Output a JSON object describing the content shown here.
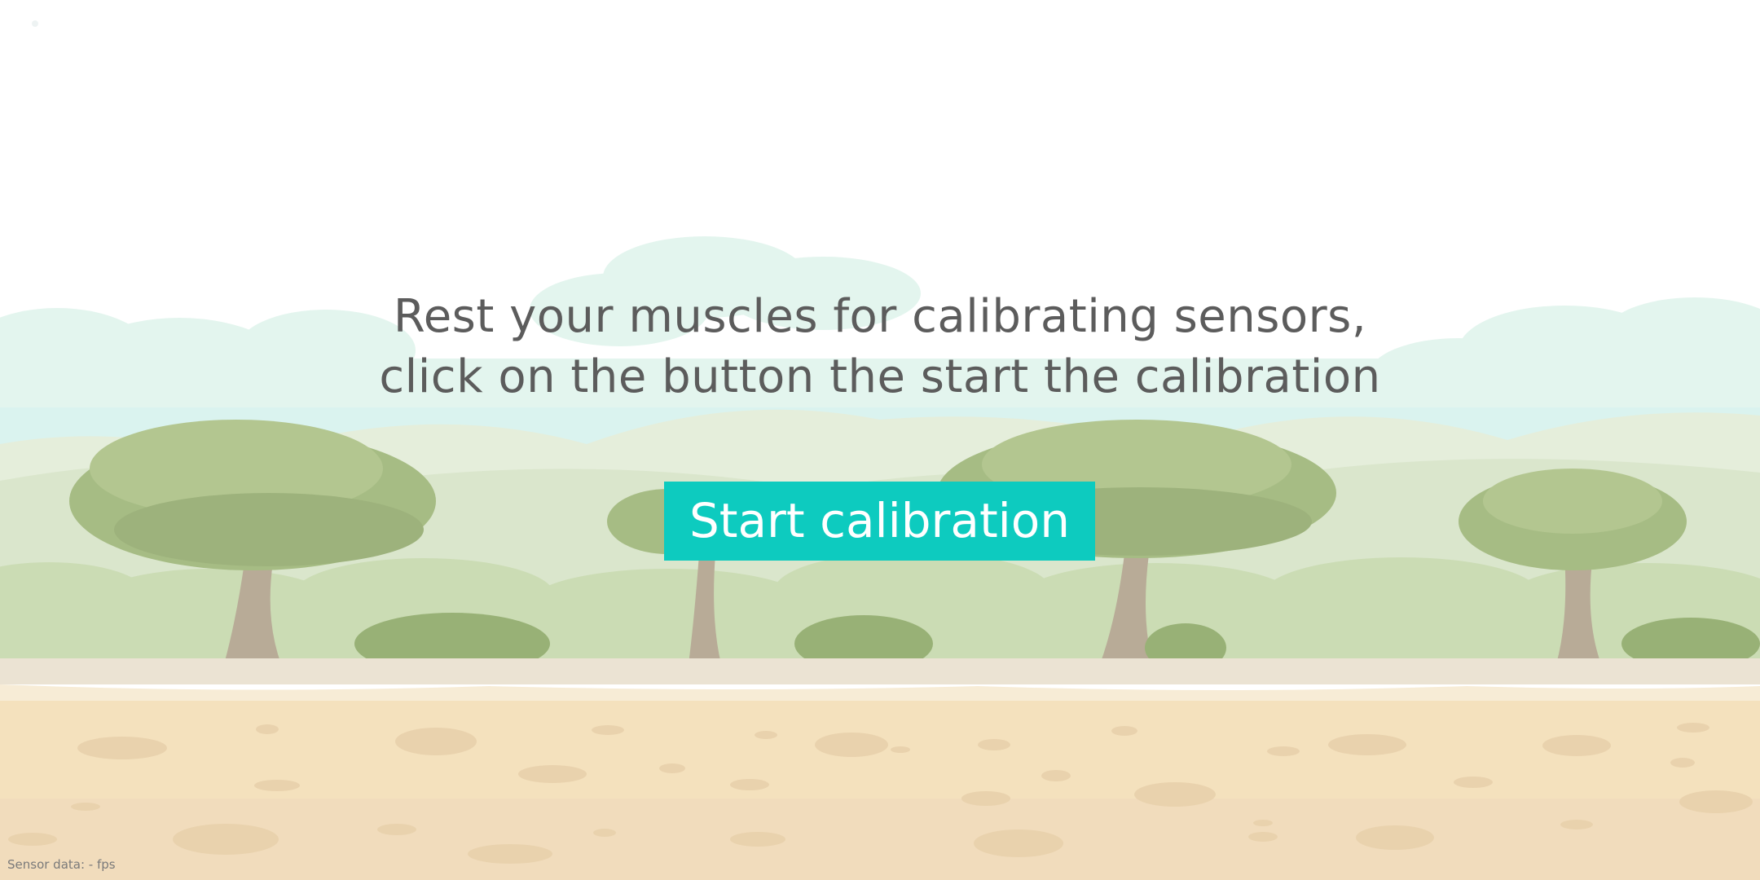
{
  "calibration": {
    "instruction_line1": "Rest your muscles for calibrating sensors,",
    "instruction_line2": "click on the button the start the calibration",
    "start_button_label": "Start calibration"
  },
  "status": {
    "sensor_data": "Sensor data: - fps"
  },
  "colors": {
    "button": "#0dcbbf",
    "text": "#5c5c5c",
    "sky": "#ffffff",
    "hills": "#dfe9d2",
    "tree_foliage": "#a9bf86",
    "ground": "#f4e2c0"
  },
  "icons": {
    "scenery": "savanna-background-with-trees"
  }
}
